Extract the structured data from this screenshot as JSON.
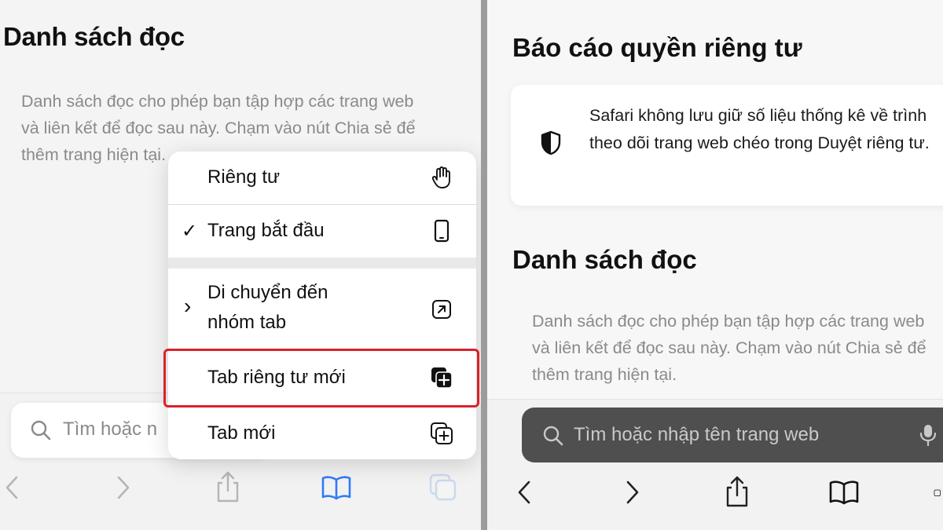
{
  "left": {
    "reading_list_title": "Danh sách đọc",
    "reading_list_desc": "Danh sách đọc cho phép bạn tập hợp các trang web và liên kết để đọc sau này. Chạm vào nút Chia sẻ để thêm trang hiện tại.",
    "search_placeholder": "Tìm hoặc n",
    "menu": {
      "items": [
        {
          "label": "Riêng tư",
          "icon": "hand-icon",
          "checked": false
        },
        {
          "label": "Trang bắt đầu",
          "icon": "phone-icon",
          "checked": true,
          "check_mark": "✓"
        },
        {
          "label": "Di chuyển đến nhóm tab",
          "line1": "Di chuyển đến",
          "line2": "nhóm tab",
          "icon": "move-arrow-icon",
          "submenu_chevron": "›"
        },
        {
          "label": "Tab riêng tư mới",
          "icon": "private-tab-plus-icon",
          "highlighted": true
        },
        {
          "label": "Tab mới",
          "icon": "tabs-plus-icon"
        }
      ]
    },
    "toolbar": [
      "back-icon",
      "forward-icon",
      "share-icon",
      "bookmarks-icon",
      "tabs-icon"
    ]
  },
  "right": {
    "privacy_title": "Báo cáo quyền riêng tư",
    "privacy_text": "Safari không lưu giữ số liệu thống kê về trình theo dõi trang web chéo trong Duyệt riêng tư.",
    "reading_list_title": "Danh sách đọc",
    "reading_list_desc": "Danh sách đọc cho phép bạn tập hợp các trang web và liên kết để đọc sau này. Chạm vào nút Chia sẻ để thêm trang hiện tại.",
    "search_placeholder": "Tìm hoặc nhập tên trang web",
    "toolbar": [
      "back-icon",
      "forward-icon",
      "share-icon",
      "bookmarks-icon",
      "tabs-icon"
    ]
  },
  "colors": {
    "highlight": "#d9222a",
    "accent_blue": "#2f7cf6",
    "dark_search": "#4f4f4f"
  }
}
